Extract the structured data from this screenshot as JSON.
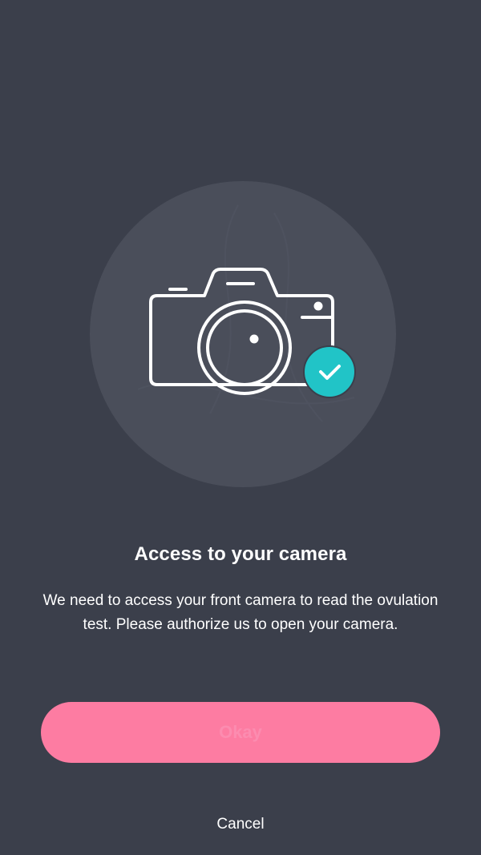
{
  "hero": {
    "illustration_icon": "camera-icon",
    "badge_icon": "check-icon",
    "badge_color": "#21c4c7",
    "circle_color": "#4a4e5a"
  },
  "content": {
    "title": "Access to your camera",
    "description": "We need to access your front camera to read the ovulation test. Please authorize us to open your camera."
  },
  "actions": {
    "primary_label": "Okay",
    "primary_color": "#fd7ca2",
    "cancel_label": "Cancel"
  },
  "colors": {
    "background": "#3b3f4b",
    "text": "#ffffff"
  }
}
